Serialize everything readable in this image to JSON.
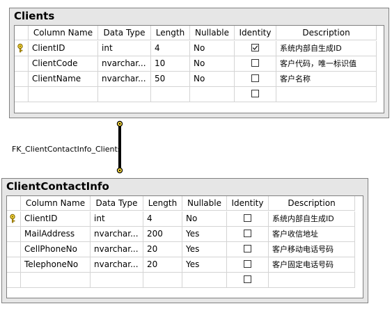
{
  "relationship": {
    "name": "FK_ClientContactInfo_Clients"
  },
  "tables": [
    {
      "title": "Clients",
      "headers": [
        "Column Name",
        "Data Type",
        "Length",
        "Nullable",
        "Identity",
        "Description"
      ],
      "rows": [
        {
          "name": "ClientID",
          "type": "int",
          "length": "4",
          "nullable": "No",
          "identity": true,
          "description": "系统内部自生成ID",
          "key": true
        },
        {
          "name": "ClientCode",
          "type": "nvarchar...",
          "length": "10",
          "nullable": "No",
          "identity": false,
          "description": "客户代码，唯一标识值",
          "key": false
        },
        {
          "name": "ClientName",
          "type": "nvarchar...",
          "length": "50",
          "nullable": "No",
          "identity": false,
          "description": "客户名称",
          "key": false
        }
      ]
    },
    {
      "title": "ClientContactInfo",
      "headers": [
        "Column Name",
        "Data Type",
        "Length",
        "Nullable",
        "Identity",
        "Description"
      ],
      "rows": [
        {
          "name": "ClientID",
          "type": "int",
          "length": "4",
          "nullable": "No",
          "identity": false,
          "description": "系统内部自生成ID",
          "key": true
        },
        {
          "name": "MailAddress",
          "type": "nvarchar...",
          "length": "200",
          "nullable": "Yes",
          "identity": false,
          "description": "客户收信地址",
          "key": false
        },
        {
          "name": "CellPhoneNo",
          "type": "nvarchar...",
          "length": "20",
          "nullable": "Yes",
          "identity": false,
          "description": "客户移动电话号码",
          "key": false
        },
        {
          "name": "TelephoneNo",
          "type": "nvarchar...",
          "length": "20",
          "nullable": "Yes",
          "identity": false,
          "description": "客户固定电话号码",
          "key": false
        }
      ]
    }
  ]
}
